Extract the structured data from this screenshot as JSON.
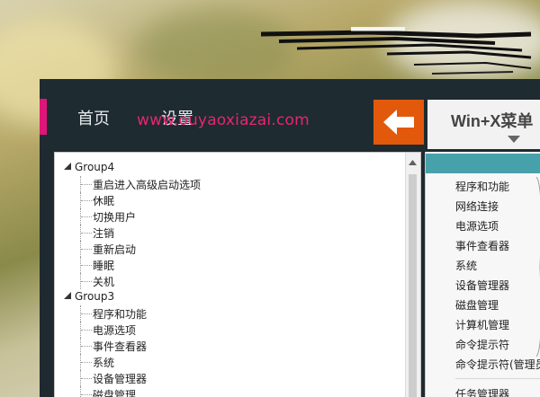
{
  "app": {
    "nav_home": "首页",
    "nav_settings": "设置",
    "back_icon": "arrow-left-icon",
    "tab_title": "Win+X菜单"
  },
  "watermark": "www.ouyaoxiazai.com",
  "tree": {
    "groups": [
      {
        "label": "Group4",
        "items": [
          "重启进入高级启动选项",
          "休眠",
          "切换用户",
          "注销",
          "重新启动",
          "睡眠",
          "关机"
        ]
      },
      {
        "label": "Group3",
        "items": [
          "程序和功能",
          "电源选项",
          "事件查看器",
          "系统",
          "设备管理器",
          "磁盘管理"
        ]
      }
    ]
  },
  "preview_list": {
    "items": [
      "程序和功能",
      "网络连接",
      "电源选项",
      "事件查看器",
      "系统",
      "设备管理器",
      "磁盘管理",
      "计算机管理",
      "命令提示符",
      "命令提示符(管理员)"
    ],
    "bottom_item": "任务管理器"
  },
  "colors": {
    "accent_pink": "#e0157a",
    "back_orange": "#e2590c",
    "header_teal": "#47a1ab",
    "window_dark": "#1f2a30"
  }
}
